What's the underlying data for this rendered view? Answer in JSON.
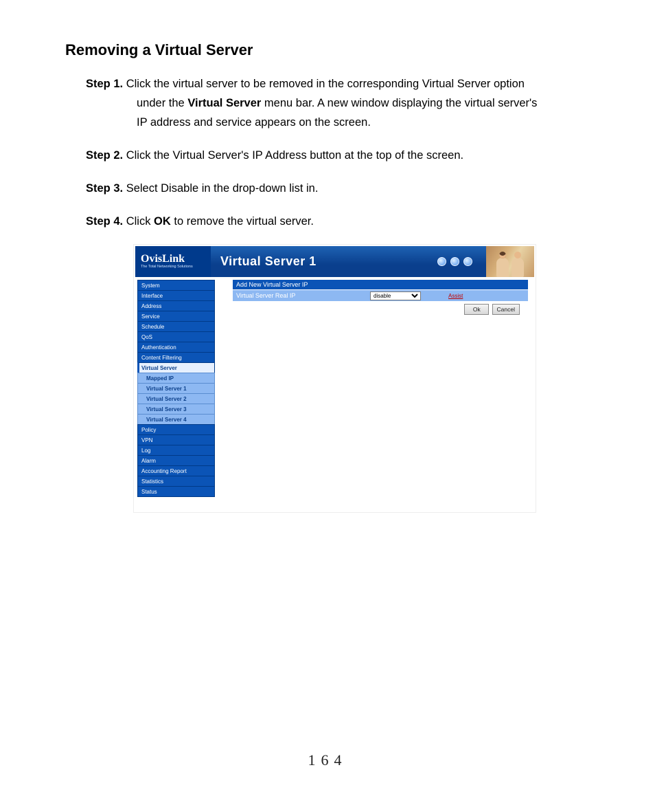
{
  "page": {
    "title": "Removing a Virtual Server",
    "number": "164"
  },
  "steps": {
    "s1": {
      "label": "Step 1.",
      "text_a": " Click the virtual server to be removed in the corresponding Virtual Server    option",
      "text_b": "under the ",
      "bold_b": "Virtual Server",
      "text_c": " menu bar. A new window displaying the virtual server's",
      "text_d": "IP address and service appears on the screen."
    },
    "s2": {
      "label": "Step 2.",
      "text": " Click the Virtual Server's IP Address button at the top of the screen."
    },
    "s3": {
      "label": "Step 3.",
      "text": " Select Disable in the drop-down list in."
    },
    "s4": {
      "label": "Step 4.",
      "text_a": " Click ",
      "bold": "OK",
      "text_b": " to remove the virtual server."
    }
  },
  "screenshot": {
    "brand": "OvisLink",
    "brand_sub": "The Total Networking Solutions",
    "header_title": "Virtual Server 1",
    "sidebar": {
      "main": [
        "System",
        "Interface",
        "Address",
        "Service",
        "Schedule",
        "QoS",
        "Authentication",
        "Content Filtering"
      ],
      "active": "Virtual Server",
      "sub": [
        "Mapped IP",
        "Virtual Server 1",
        "Virtual Server 2",
        "Virtual Server 3",
        "Virtual Server 4"
      ],
      "tail": [
        "Policy",
        "VPN",
        "Log",
        "Alarm",
        "Accounting Report",
        "Statistics",
        "Status"
      ]
    },
    "form": {
      "header": "Add New Virtual Server IP",
      "row_label": "Virtual Server Real IP",
      "select_value": "disable",
      "assist": "Assist",
      "ok": "Ok",
      "cancel": "Cancel"
    }
  }
}
